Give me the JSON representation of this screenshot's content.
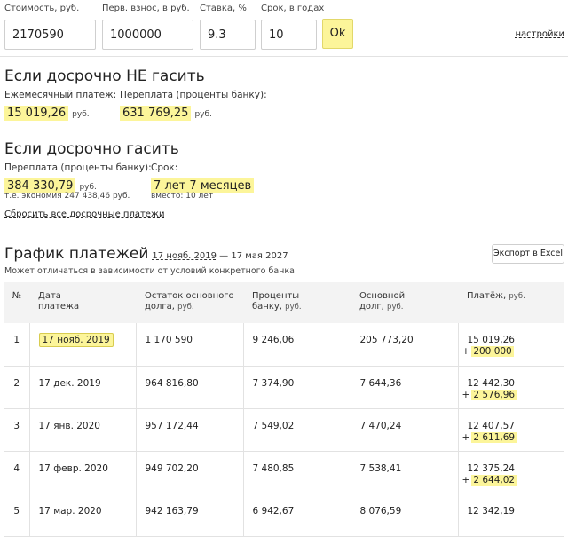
{
  "form": {
    "cost_label": "Стоимость, руб.",
    "cost_value": "2170590",
    "down_label_prefix": "Перв. взнос,",
    "down_label_unit": "в руб.",
    "down_value": "1000000",
    "rate_label": "Ставка, %",
    "rate_value": "9.3",
    "term_label_prefix": "Срок,",
    "term_label_unit": "в годах",
    "term_value": "10",
    "ok_label": "Ok",
    "settings_label": "настройки"
  },
  "no_early": {
    "title": "Если досрочно НЕ гасить",
    "monthly_label": "Ежемесячный платёж:",
    "monthly_value": "15 019,26",
    "monthly_unit": "руб.",
    "overpay_label": "Переплата (проценты банку):",
    "overpay_value": "631 769,25",
    "overpay_unit": "руб."
  },
  "early": {
    "title": "Если досрочно гасить",
    "overpay_label": "Переплата (проценты банку):",
    "overpay_value": "384 330,79",
    "overpay_unit": "руб.",
    "saving_text": "т.е. экономия 247 438,46 руб.",
    "term_label": "Срок:",
    "term_value": "7 лет 7 месяцев",
    "term_instead": "вместо: 10 лет",
    "reset_label": "Сбросить все досрочные платежи"
  },
  "schedule": {
    "title": "График платежей",
    "range_start": "17 нояб. 2019",
    "range_sep": "—",
    "range_end": "17 мая 2027",
    "export_label": "Экспорт в Excel",
    "note": "Может отличаться в зависимости от условий конкретного банка.",
    "headers": {
      "num": "№",
      "date_line1": "Дата",
      "date_line2": "платежа",
      "balance_line1": "Остаток основного",
      "balance_line2": "долга,",
      "balance_unit": "руб.",
      "interest_line1": "Проценты",
      "interest_line2": "банку,",
      "interest_unit": "руб.",
      "principal_line1": "Основной",
      "principal_line2": "долг,",
      "principal_unit": "руб.",
      "payment_line1": "Платёж,",
      "payment_unit": "руб."
    },
    "rows": [
      {
        "num": "1",
        "date": "17 нояб. 2019",
        "balance": "1 170 590",
        "interest": "9 246,06",
        "principal": "205 773,20",
        "payment": "15 019,26",
        "plus": "+",
        "extra": "200 000"
      },
      {
        "num": "2",
        "date": "17 дек. 2019",
        "balance": "964 816,80",
        "interest": "7 374,90",
        "principal": "7 644,36",
        "payment": "12 442,30",
        "plus": "+",
        "extra": "2 576,96"
      },
      {
        "num": "3",
        "date": "17 янв. 2020",
        "balance": "957 172,44",
        "interest": "7 549,02",
        "principal": "7 470,24",
        "payment": "12 407,57",
        "plus": "+",
        "extra": "2 611,69"
      },
      {
        "num": "4",
        "date": "17 февр. 2020",
        "balance": "949 702,20",
        "interest": "7 480,85",
        "principal": "7 538,41",
        "payment": "12 375,24",
        "plus": "+",
        "extra": "2 644,02"
      },
      {
        "num": "5",
        "date": "17 мар. 2020",
        "balance": "942 163,79",
        "interest": "6 942,67",
        "principal": "8 076,59",
        "payment": "12 342,19",
        "plus": "",
        "extra": ""
      }
    ]
  }
}
